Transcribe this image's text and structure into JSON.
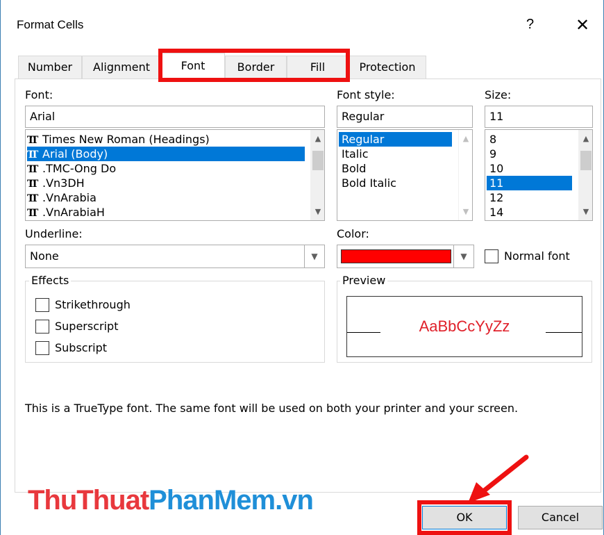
{
  "window": {
    "title": "Format Cells",
    "help_label": "?",
    "close_label": "✕"
  },
  "tabs": [
    {
      "label": "Number"
    },
    {
      "label": "Alignment"
    },
    {
      "label": "Font"
    },
    {
      "label": "Border"
    },
    {
      "label": "Fill"
    },
    {
      "label": "Protection"
    }
  ],
  "font": {
    "label": "Font:",
    "value": "Arial",
    "items": [
      {
        "label": "Times New Roman (Headings)"
      },
      {
        "label": "Arial (Body)"
      },
      {
        "label": ".TMC-Ong Do"
      },
      {
        "label": ".Vn3DH"
      },
      {
        "label": ".VnArabia"
      },
      {
        "label": ".VnArabiaH"
      }
    ],
    "selected_index": 1
  },
  "font_style": {
    "label": "Font style:",
    "value": "Regular",
    "items": [
      {
        "label": "Regular"
      },
      {
        "label": "Italic"
      },
      {
        "label": "Bold"
      },
      {
        "label": "Bold Italic"
      }
    ],
    "selected_index": 0
  },
  "size": {
    "label": "Size:",
    "value": "11",
    "items": [
      {
        "label": "8"
      },
      {
        "label": "9"
      },
      {
        "label": "10"
      },
      {
        "label": "11"
      },
      {
        "label": "12"
      },
      {
        "label": "14"
      }
    ],
    "selected_index": 3
  },
  "underline": {
    "label": "Underline:",
    "value": "None"
  },
  "color": {
    "label": "Color:",
    "value_hex": "#ff0000"
  },
  "normal_font": {
    "label": "Normal font",
    "checked": false
  },
  "effects": {
    "title": "Effects",
    "items": [
      {
        "label": "Strikethrough",
        "checked": false
      },
      {
        "label": "Superscript",
        "checked": false
      },
      {
        "label": "Subscript",
        "checked": false
      }
    ]
  },
  "preview": {
    "title": "Preview",
    "sample": "AaBbCcYyZz",
    "sample_color": "#e0202a"
  },
  "info_text": "This is a TrueType font.  The same font will be used on both your printer and your screen.",
  "buttons": {
    "ok": "OK",
    "cancel": "Cancel"
  },
  "watermark": {
    "part1": "ThuThuat",
    "part2": "PhanMem",
    "part3": ".vn",
    "color1": "#e8383d",
    "color2": "#1f8fd8"
  },
  "colors": {
    "highlight": "#ee1111",
    "selection": "#0078d7"
  }
}
